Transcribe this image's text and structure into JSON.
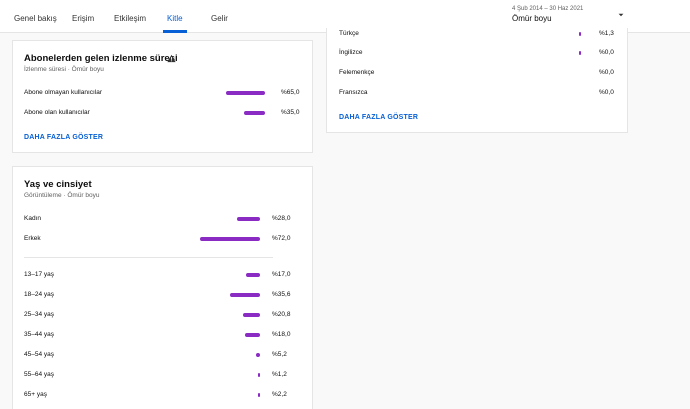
{
  "tabs": [
    {
      "label": "Genel bakış",
      "active": false
    },
    {
      "label": "Erişim",
      "active": false
    },
    {
      "label": "Etkileşim",
      "active": false
    },
    {
      "label": "Kitle",
      "active": true
    },
    {
      "label": "Gelir",
      "active": false
    }
  ],
  "period": {
    "date_range": "4 Şub 2014 – 30 Haz 2021",
    "label": "Ömür boyu"
  },
  "subscriber_watch_card": {
    "title": "Abonelerden gelen izlenme süresi",
    "subtitle": "İzlenme süresi · Ömür boyu",
    "rows": [
      {
        "label": "Abone olmayan kullanıcılar",
        "value": "%65,0",
        "fraction": 0.65
      },
      {
        "label": "Abone olan kullanıcılar",
        "value": "%35,0",
        "fraction": 0.35
      }
    ],
    "more_label": "DAHA FAZLA GÖSTER"
  },
  "language_card": {
    "rows": [
      {
        "label": "Türkçe",
        "value": "%1,3",
        "fraction": 0.013
      },
      {
        "label": "İngilizce",
        "value": "%0,0",
        "fraction": 0.0
      },
      {
        "label": "Felemenkçe",
        "value": "%0,0",
        "fraction": 0.0
      },
      {
        "label": "Fransızca",
        "value": "%0,0",
        "fraction": 0.0
      }
    ],
    "more_label": "DAHA FAZLA GÖSTER"
  },
  "age_gender_card": {
    "title": "Yaş ve cinsiyet",
    "subtitle": "Görüntüleme · Ömür boyu",
    "gender_rows": [
      {
        "label": "Kadın",
        "value": "%28,0",
        "fraction": 0.28
      },
      {
        "label": "Erkek",
        "value": "%72,0",
        "fraction": 0.72
      }
    ],
    "age_rows": [
      {
        "label": "13–17 yaş",
        "value": "%17,0",
        "fraction": 0.17
      },
      {
        "label": "18–24 yaş",
        "value": "%35,6",
        "fraction": 0.356
      },
      {
        "label": "25–34 yaş",
        "value": "%20,8",
        "fraction": 0.208
      },
      {
        "label": "35–44 yaş",
        "value": "%18,0",
        "fraction": 0.18
      },
      {
        "label": "45–54 yaş",
        "value": "%5,2",
        "fraction": 0.052
      },
      {
        "label": "55–64 yaş",
        "value": "%1,2",
        "fraction": 0.012
      },
      {
        "label": "65+ yaş",
        "value": "%2,2",
        "fraction": 0.022
      }
    ]
  },
  "colors": {
    "bar": "#8a2bc4",
    "accent": "#065fd4"
  }
}
